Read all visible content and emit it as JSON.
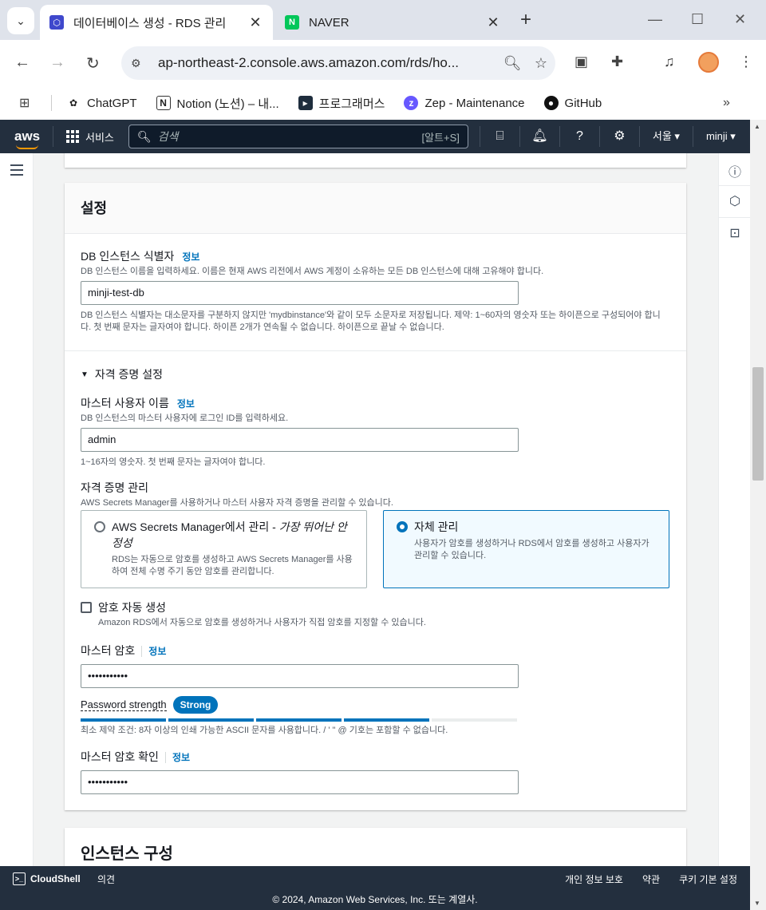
{
  "browser": {
    "tabs": [
      {
        "title": "데이터베이스 생성 - RDS 관리",
        "active": true,
        "favicon": "aws-rds-icon"
      },
      {
        "title": "NAVER",
        "active": false,
        "favicon": "naver-icon"
      }
    ],
    "url": "ap-northeast-2.console.aws.amazon.com/rds/ho...",
    "bookmarks": [
      {
        "label": "ChatGPT",
        "icon": "chatgpt-icon"
      },
      {
        "label": "Notion (노션) – 내...",
        "icon": "notion-icon"
      },
      {
        "label": "프로그래머스",
        "icon": "programmers-icon"
      },
      {
        "label": "Zep - Maintenance",
        "icon": "zep-icon"
      },
      {
        "label": "GitHub",
        "icon": "github-icon"
      }
    ]
  },
  "aws_nav": {
    "logo": "aws",
    "services": "서비스",
    "search_placeholder": "검색",
    "search_shortcut": "[알트+S]",
    "region": "서울 ▾",
    "user": "minji ▾"
  },
  "settings": {
    "title": "설정",
    "db_identifier": {
      "label": "DB 인스턴스 식별자",
      "info": "정보",
      "description": "DB 인스턴스 이름을 입력하세요. 이름은 현재 AWS 리전에서 AWS 계정이 소유하는 모든 DB 인스턴스에 대해 고유해야 합니다.",
      "value": "minji-test-db",
      "constraint": "DB 인스턴스 식별자는 대소문자를 구분하지 않지만 'mydbinstance'와 같이 모두 소문자로 저장됩니다. 제약: 1~60자의 영숫자 또는 하이픈으로 구성되어야 합니다. 첫 번째 문자는 글자여야 합니다. 하이픈 2개가 연속될 수 없습니다. 하이픈으로 끝날 수 없습니다."
    },
    "credentials_section": "자격 증명 설정",
    "master_username": {
      "label": "마스터 사용자 이름",
      "info": "정보",
      "description": "DB 인스턴스의 마스터 사용자에 로그인 ID를 입력하세요.",
      "value": "admin",
      "constraint": "1~16자의 영숫자. 첫 번째 문자는 글자여야 합니다."
    },
    "credential_management": {
      "label": "자격 증명 관리",
      "description": "AWS Secrets Manager를 사용하거나 마스터 사용자 자격 증명을 관리할 수 있습니다.",
      "options": [
        {
          "title": "AWS Secrets Manager에서 관리 - ",
          "title_em": "가장 뛰어난 안정성",
          "description": "RDS는 자동으로 암호를 생성하고 AWS Secrets Manager를 사용하여 전체 수명 주기 동안 암호를 관리합니다.",
          "selected": false
        },
        {
          "title": "자체 관리",
          "description": "사용자가 암호를 생성하거나 RDS에서 암호를 생성하고 사용자가 관리할 수 있습니다.",
          "selected": true
        }
      ]
    },
    "auto_password": {
      "label": "암호 자동 생성",
      "description": "Amazon RDS에서 자동으로 암호를 생성하거나 사용자가 직접 암호를 지정할 수 있습니다.",
      "checked": false
    },
    "master_password": {
      "label": "마스터 암호",
      "info": "정보",
      "value": "•••••••••••",
      "strength_label": "Password strength",
      "strength": "Strong",
      "strength_level": 0.75,
      "constraint": "최소 제약 조건: 8자 이상의 인쇄 가능한 ASCII 문자를 사용합니다. / ' \" @ 기호는 포함할 수 없습니다."
    },
    "confirm_password": {
      "label": "마스터 암호 확인",
      "info": "정보",
      "value": "•••••••••••"
    }
  },
  "instance_config": {
    "title": "인스턴스 구성"
  },
  "footer": {
    "cloudshell": "CloudShell",
    "feedback": "의견",
    "links": [
      "개인 정보 보호",
      "약관",
      "쿠키 기본 설정"
    ],
    "copyright": "© 2024, Amazon Web Services, Inc. 또는 계열사."
  },
  "colors": {
    "accent": "#0073bb",
    "aws_nav": "#232f3e",
    "aws_orange": "#ff9900"
  }
}
